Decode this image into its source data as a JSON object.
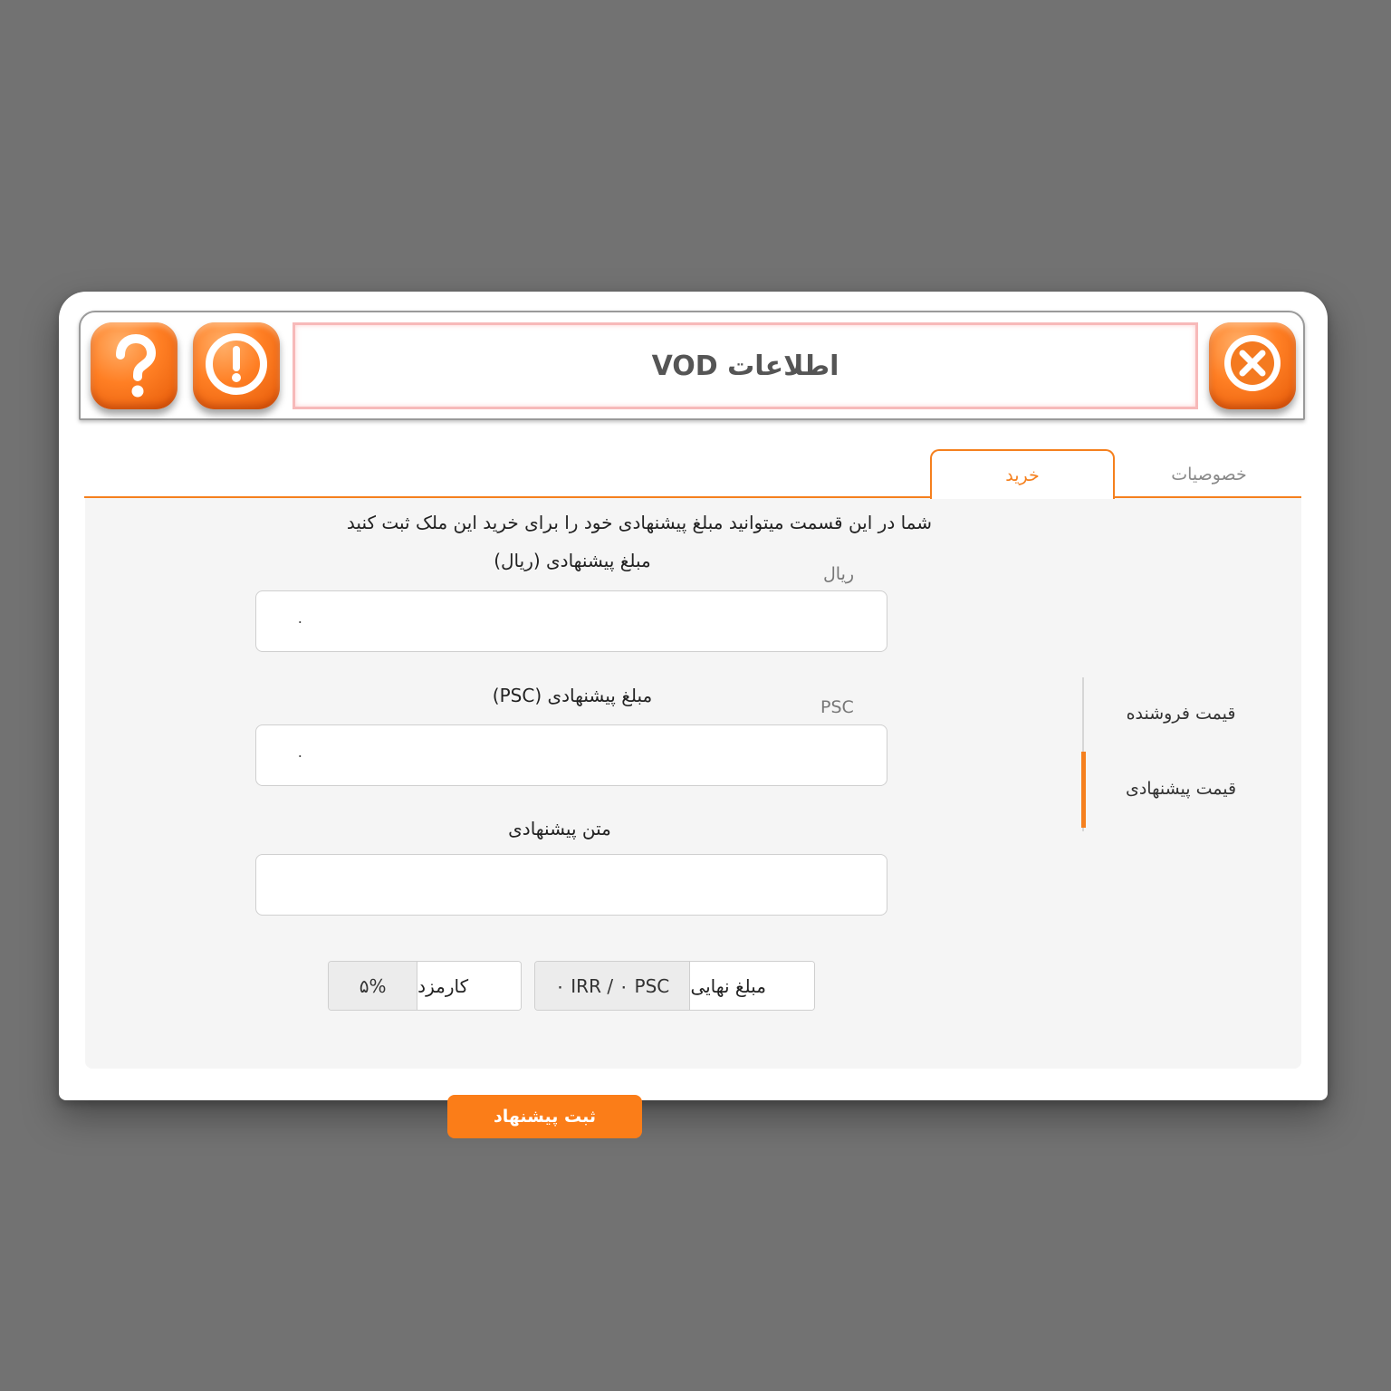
{
  "titlebar": {
    "title": "اطلاعات VOD",
    "help_icon": "question-mark-icon",
    "info_icon": "exclamation-icon",
    "close_icon": "close-x-icon"
  },
  "tabs": [
    {
      "label": "خرید",
      "active": true
    },
    {
      "label": "خصوصیات",
      "active": false
    }
  ],
  "form": {
    "intro": "شما در این قسمت میتوانید مبلغ پیشنهادی خود را برای خرید این ملک ثبت کنید",
    "rial_field": {
      "label": "مبلغ پیشنهادی (ریال)",
      "unit": "ریال",
      "value": "۰"
    },
    "psc_field": {
      "label": "مبلغ پیشنهادی (PSC)",
      "unit": "PSC",
      "value": "۰"
    },
    "text_field": {
      "label": "متن پیشنهادی",
      "value": ""
    },
    "fee": {
      "label": "کارمزد",
      "value": "۵%"
    },
    "final_amount": {
      "label": "مبلغ نهایی",
      "value": "۰ IRR / ۰ PSC"
    },
    "submit_label": "ثبت پیشنهاد"
  },
  "side_menu": [
    {
      "label": "قیمت فروشنده",
      "active": false
    },
    {
      "label": "قیمت پیشنهادی",
      "active": true
    }
  ],
  "colors": {
    "accent": "#f5801e",
    "button": "#fb7d18",
    "background": "#727272"
  }
}
